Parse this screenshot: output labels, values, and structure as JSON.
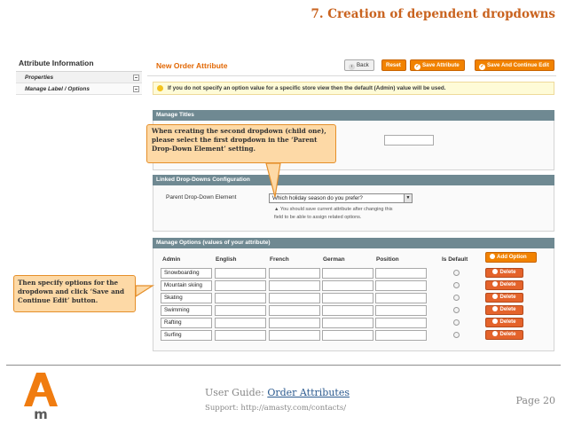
{
  "slide": {
    "title": "7. Creation of dependent dropdowns",
    "footer": {
      "guide_prefix": "User Guide: ",
      "guide_link": "Order Attributes",
      "support": "Support: http://amasty.com/contacts/",
      "page": "Page 20"
    }
  },
  "left_panel": {
    "title": "Attribute Information",
    "items": [
      {
        "label": "Properties"
      },
      {
        "label": "Manage Label / Options"
      }
    ]
  },
  "main": {
    "heading": "New Order Attribute",
    "buttons": {
      "back": "Back",
      "reset": "Reset",
      "save": "Save Attribute",
      "save_continue": "Save And Continue Edit"
    },
    "notice": "If you do not specify an option value for a specific store view then the default (Admin) value will be used.",
    "manage_titles": {
      "header": "Manage Titles"
    },
    "linked": {
      "header": "Linked Drop-Downs Configuration",
      "label": "Parent Drop-Down Element",
      "selected": "Which holiday season do you prefer?",
      "note_line1": "▲ You should save current attribute after changing this",
      "note_line2": "field to be able to assign related options."
    },
    "options": {
      "header": "Manage Options (values of your attribute)",
      "columns": [
        "Admin",
        "English",
        "French",
        "German",
        "Position",
        "Is Default"
      ],
      "add_label": "Add Option",
      "delete_label": "Delete",
      "rows": [
        "Snowboarding",
        "Mountain skiing",
        "Skating",
        "Swimming",
        "Rafting",
        "Surfing"
      ]
    }
  },
  "callouts": {
    "first": "When creating the second dropdown (child one), please select the first dropdown in the ‘Parent Drop-Down Element’ setting.",
    "second": "Then specify options for the dropdown and click ‘Save and Continue Edit’ button."
  }
}
